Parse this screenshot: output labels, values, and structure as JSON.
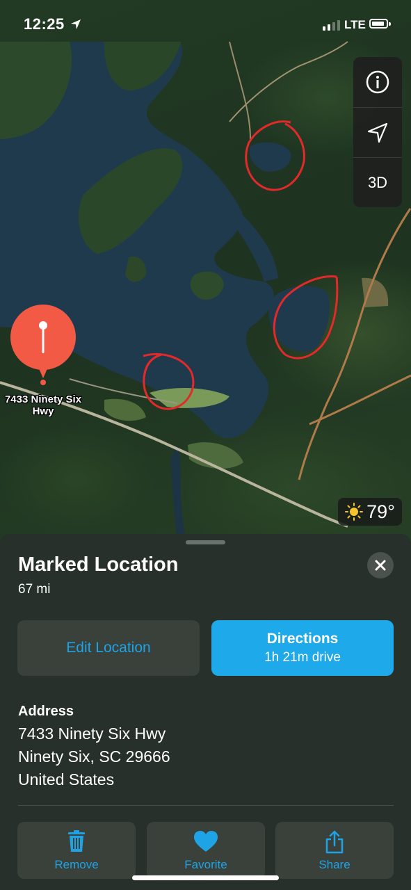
{
  "status_bar": {
    "time": "12:25",
    "network": "LTE",
    "signal_bars_filled": 2,
    "signal_bars_total": 4
  },
  "map": {
    "controls": {
      "info_icon": "info-icon",
      "location_icon": "location-arrow-icon",
      "three_d_label": "3D"
    },
    "pin": {
      "label": "7433 Ninety Six Hwy",
      "color": "#f25a45"
    },
    "annotation_color": "#e32a2a",
    "weather": {
      "icon": "sun-icon",
      "temperature": "79°"
    }
  },
  "sheet": {
    "title": "Marked Location",
    "distance": "67 mi",
    "edit_button": "Edit Location",
    "directions_button": "Directions",
    "directions_sub": "1h 21m drive",
    "address_header": "Address",
    "address_lines": [
      "7433 Ninety Six Hwy",
      "Ninety Six, SC  29666",
      "United States"
    ],
    "actions": [
      {
        "label": "Remove",
        "icon": "trash-icon"
      },
      {
        "label": "Favorite",
        "icon": "heart-icon"
      },
      {
        "label": "Share",
        "icon": "share-icon"
      }
    ],
    "accent_color": "#1ea4e6"
  }
}
